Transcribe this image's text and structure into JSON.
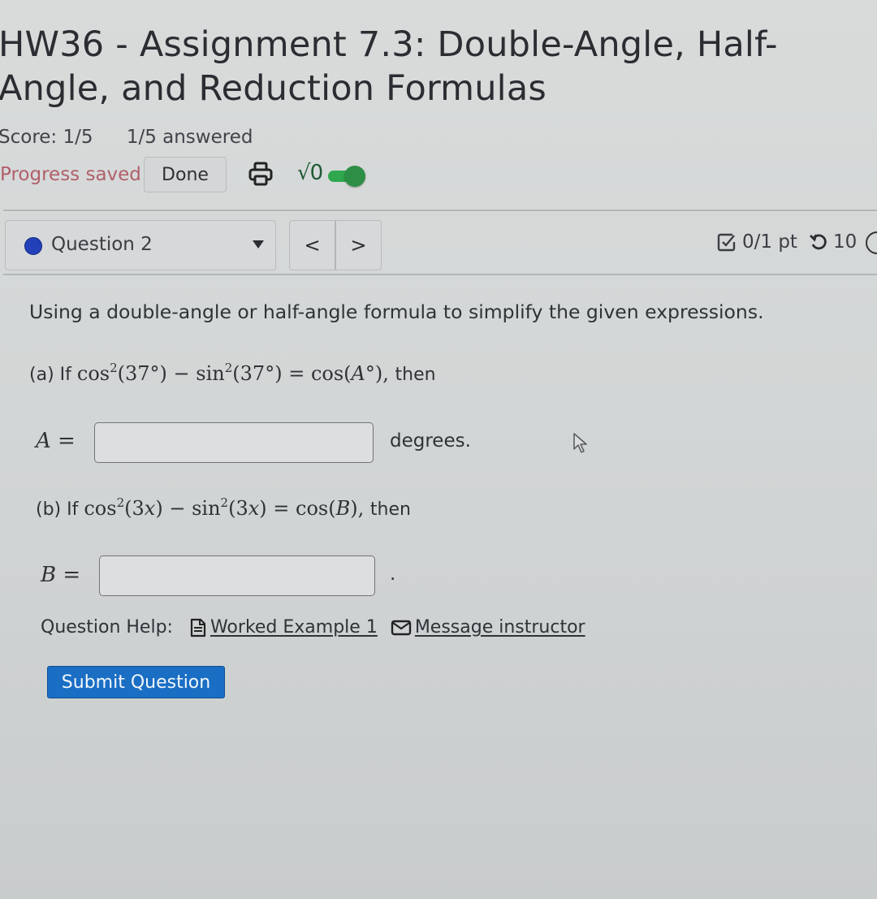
{
  "header": {
    "title": "HW36 - Assignment 7.3: Double-Angle, Half-Angle, and Reduction Formulas",
    "score": "Score: 1/5",
    "answered": "1/5 answered",
    "progress_status": "Progress saved",
    "done_label": "Done",
    "print_icon": "printer-icon",
    "math_icon_label": "√0",
    "math_toggle_on": true
  },
  "question_nav": {
    "selected_question": "Question 2",
    "status_dot_color": "#2240b8",
    "prev_label": "<",
    "next_label": ">",
    "points": "0/1 pt",
    "attempts": "10"
  },
  "question": {
    "prompt": "Using a double-angle or half-angle formula to simplify the given expressions.",
    "part_a": {
      "prefix": "(a) If",
      "expression": {
        "f1": "cos",
        "exp1": "2",
        "arg1": "(37°)",
        "minus": "−",
        "f2": "sin",
        "exp2": "2",
        "arg2": "(37°)",
        "eq": "=",
        "rhs_f": "cos(",
        "rhs_var": "A",
        "rhs_tail": "°),"
      },
      "suffix": "then",
      "var_label": "A",
      "equals": "=",
      "input_value": "",
      "unit": "degrees."
    },
    "part_b": {
      "prefix": "(b) If",
      "expression": {
        "f1": "cos",
        "exp1": "2",
        "arg1_open": "(3",
        "arg1_var": "x",
        "arg1_close": ")",
        "minus": "−",
        "f2": "sin",
        "exp2": "2",
        "arg2_open": "(3",
        "arg2_var": "x",
        "arg2_close": ")",
        "eq": "=",
        "rhs_f": "cos(",
        "rhs_var": "B",
        "rhs_tail": "),"
      },
      "suffix": "then",
      "var_label": "B",
      "equals": "=",
      "input_value": "",
      "unit": "."
    },
    "help": {
      "label": "Question Help:",
      "worked_example": "Worked Example 1",
      "message_instructor": "Message instructor"
    },
    "submit_label": "Submit Question"
  },
  "colors": {
    "submit_blue": "#1a6ec4",
    "progress_saved": "#b0606a",
    "toggle_green": "#2c8f45"
  }
}
